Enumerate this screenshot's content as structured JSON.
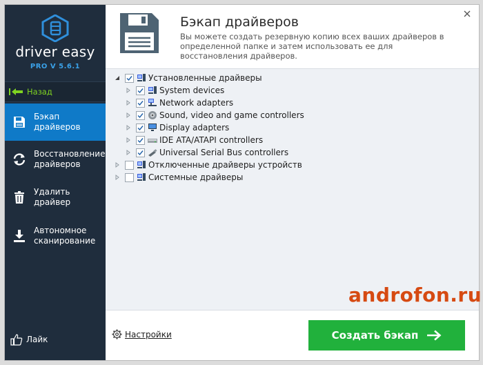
{
  "app": {
    "brand": "driver easy",
    "version": "PRO V 5.6.1"
  },
  "sidebar": {
    "back_label": "Назад",
    "items": [
      {
        "label": "Бэкап драйверов",
        "icon": "floppy-icon",
        "active": true
      },
      {
        "label": "Восстановление драйверов",
        "icon": "restore-arrows-icon",
        "active": false
      },
      {
        "label": "Удалить драйвер",
        "icon": "trash-icon",
        "active": false
      },
      {
        "label": "Автономное сканирование",
        "icon": "download-scan-icon",
        "active": false
      }
    ],
    "like_label": "Лайк"
  },
  "header": {
    "title": "Бэкап драйверов",
    "description": "Вы можете создать резервную копию всех ваших драйверов в определенной папке и затем использовать ее для восстановления драйверов."
  },
  "tree": [
    {
      "label": "Установленные драйверы",
      "level": 0,
      "expanded": true,
      "checked": true,
      "icon": "computer-icon"
    },
    {
      "label": "System devices",
      "level": 1,
      "expanded": false,
      "checked": true,
      "icon": "computer-icon"
    },
    {
      "label": "Network adapters",
      "level": 1,
      "expanded": false,
      "checked": true,
      "icon": "network-icon"
    },
    {
      "label": "Sound, video and game controllers",
      "level": 1,
      "expanded": false,
      "checked": true,
      "icon": "speaker-icon"
    },
    {
      "label": "Display adapters",
      "level": 1,
      "expanded": false,
      "checked": true,
      "icon": "monitor-icon"
    },
    {
      "label": "IDE ATA/ATAPI controllers",
      "level": 1,
      "expanded": false,
      "checked": true,
      "icon": "drive-icon"
    },
    {
      "label": "Universal Serial Bus controllers",
      "level": 1,
      "expanded": false,
      "checked": true,
      "icon": "usb-icon"
    },
    {
      "label": "Отключенные драйверы устройств",
      "level": 0,
      "expanded": false,
      "checked": false,
      "icon": "computer-icon"
    },
    {
      "label": "Системные драйверы",
      "level": 0,
      "expanded": false,
      "checked": false,
      "icon": "computer-icon"
    }
  ],
  "footer": {
    "settings_label": "Настройки",
    "create_label": "Создать бэкап"
  },
  "watermark": "androfon.ru",
  "colors": {
    "sidebar_bg": "#1f2d3d",
    "active_item": "#0f7ac8",
    "accent_green": "#21b13c",
    "back_green": "#7fd321",
    "version_blue": "#3aa1e8"
  }
}
